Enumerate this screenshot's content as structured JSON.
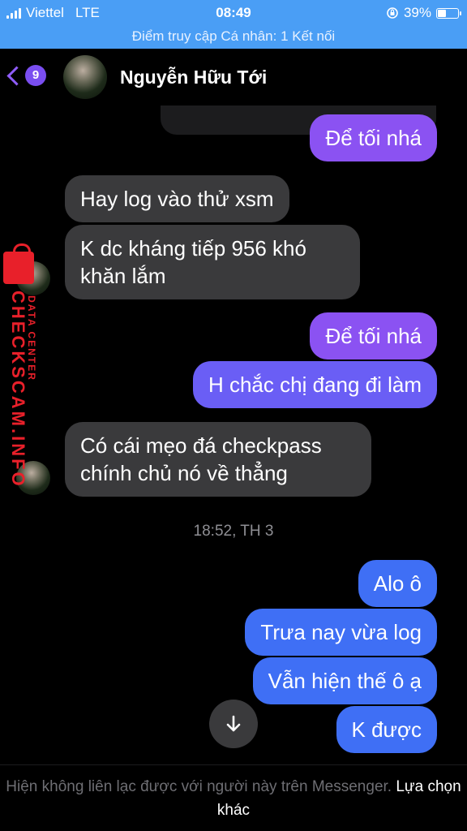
{
  "status_bar": {
    "carrier": "Viettel",
    "network": "LTE",
    "time": "08:49",
    "battery": "39%"
  },
  "hotspot_banner": "Điểm truy cập Cá nhân: 1 Kết nối",
  "header": {
    "back_badge": "9",
    "contact_name": "Nguyễn Hữu Tới"
  },
  "messages": [
    {
      "text": "Để tối nhá",
      "dir": "out"
    },
    {
      "text": "Hay log vào thử xsm",
      "dir": "in"
    },
    {
      "text": "K dc kháng tiếp 956 khó khăn lắm",
      "dir": "in"
    },
    {
      "text": "Để tối nhá",
      "dir": "out"
    },
    {
      "text": "H chắc chị đang đi  làm",
      "dir": "out"
    },
    {
      "text": "Có cái mẹo đá checkpass chính chủ nó về thẳng",
      "dir": "in"
    },
    {
      "text": "Alo ô",
      "dir": "out"
    },
    {
      "text": "Trưa nay vừa log",
      "dir": "out"
    },
    {
      "text": "Vẫn hiện thế ô ạ",
      "dir": "out"
    },
    {
      "text": "K được",
      "dir": "out"
    }
  ],
  "timestamp": "18:52, TH 3",
  "watermark": {
    "main": "CHECKSCAM.INFO",
    "sub": "DATA CENTER"
  },
  "footer": {
    "notice": "Hiện không liên lạc được với người này trên Messenger.",
    "link": "Lựa chọn khác"
  },
  "colors": {
    "status_bar": "#4a9ef5",
    "sent_purple": "#8b52f2",
    "sent_violet": "#6a5ef5",
    "sent_blue": "#3f6ff5",
    "received": "#3a3a3c",
    "watermark": "#e8202a"
  }
}
